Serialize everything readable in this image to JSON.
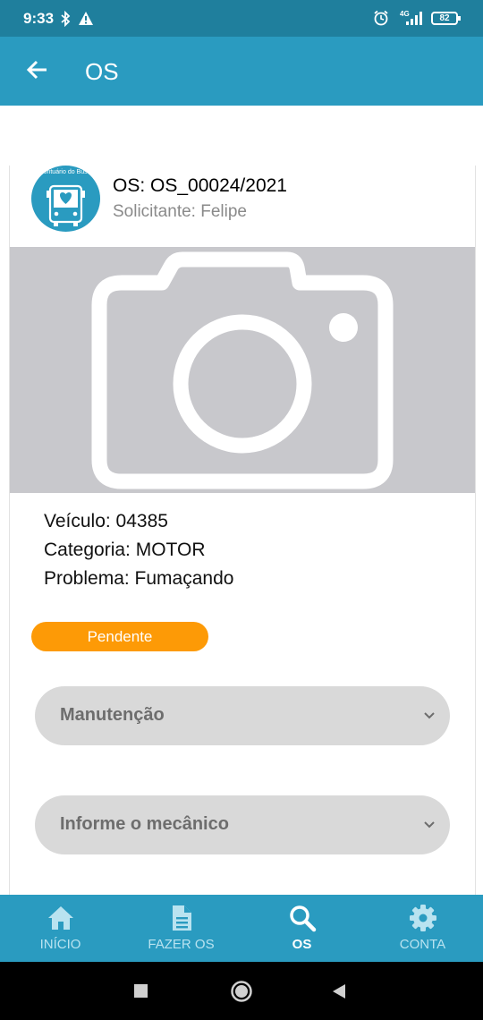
{
  "status_bar": {
    "time": "9:33",
    "network": "4G",
    "battery": "82"
  },
  "app_bar": {
    "title": "OS"
  },
  "os": {
    "logo_text": "Prontuário do Busão",
    "title": "OS: OS_00024/2021",
    "requester": "Solicitante: Felipe",
    "vehicle": "Veículo: 04385",
    "category": "Categoria: MOTOR",
    "problem": "Problema: Fumaçando",
    "status": "Pendente"
  },
  "dropdowns": {
    "maintenance": "Manutenção",
    "mechanic": "Informe o mecânico"
  },
  "bottom_nav": {
    "items": [
      {
        "label": "INÍCIO",
        "icon": "home-icon"
      },
      {
        "label": "FAZER OS",
        "icon": "document-icon"
      },
      {
        "label": "OS",
        "icon": "search-icon",
        "active": true
      },
      {
        "label": "CONTA",
        "icon": "gear-icon"
      }
    ]
  },
  "colors": {
    "primary": "#2a9bc0",
    "status_bar": "#1f7f9d",
    "pending": "#fd9a06"
  }
}
